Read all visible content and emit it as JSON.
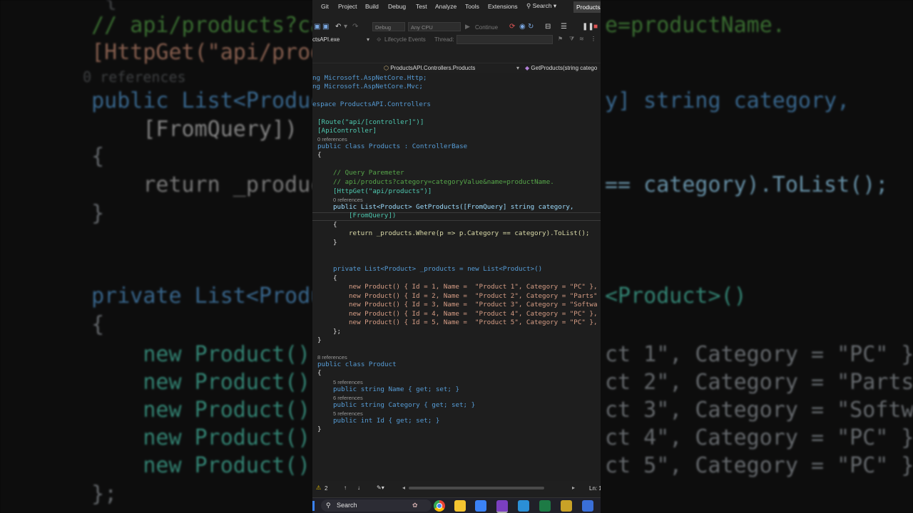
{
  "background_code": {
    "lines": [
      "   {",
      "  // api/products?cate",
      "  [HttpGet(\"api/produc",
      "  0 references",
      "  public List<Product>",
      "      [FromQuery])",
      "  {",
      "      return _products",
      "  }",
      "  private List<Product",
      "  {",
      "      new Product() {",
      "      new Product() {",
      "      new Product() {",
      "      new Product() {",
      "      new Product() {",
      "  };"
    ],
    "right_lines": [
      "e=productName.",
      "y] string category,",
      "== category).ToList();",
      "<Product>()",
      "ct 1\", Category = \"PC\" },",
      "ct 2\", Category = \"Parts\"",
      "ct 3\", Category = \"Softwa",
      "ct 4\", Category = \"PC\" },",
      "ct 5\", Category = \"PC\" },"
    ]
  },
  "menu": {
    "items": [
      "Git",
      "Project",
      "Build",
      "Debug",
      "Test",
      "Analyze",
      "Tools",
      "Extensions"
    ],
    "search_label": "Search",
    "project_badge": "ProductsAPI"
  },
  "toolbar": {
    "config": "Debug",
    "platform": "Any CPU",
    "continue_label": "Continue",
    "startup": "ctsAPI.exe",
    "lifecycle": "Lifecycle Events",
    "thread_label": "Thread:"
  },
  "navbar": {
    "class_path": "ProductsAPI.Controllers.Products",
    "member": "GetProducts(string catego"
  },
  "code": {
    "l01": "ng Microsoft.AspNetCore.Http;",
    "l02": "ng Microsoft.AspNetCore.Mvc;",
    "l03": "espace ProductsAPI.Controllers",
    "l04": "[Route(\"api/[controller]\")]",
    "l05": "[ApiController]",
    "r05": "0 references",
    "l06": "public class Products : ControllerBase",
    "l07": "{",
    "l08": "// Query Paremeter",
    "l09": "// api/products?category=categoryValue&name=productName.",
    "l10": "[HttpGet(\"api/products\")]",
    "r10": "0 references",
    "l11": "public List<Product> GetProducts([FromQuery] string category,",
    "l12": "[FromQuery])",
    "l13": "{",
    "l14": "return _products.Where(p => p.Category == category).ToList();",
    "l15": "}",
    "l16": "private List<Product> _products = new List<Product>()",
    "l17": "{",
    "p1": "new Product() { Id = 1, Name =  \"Product 1\", Category = \"PC\" },",
    "p2": "new Product() { Id = 2, Name =  \"Product 2\", Category = \"Parts\"",
    "p3": "new Product() { Id = 3, Name =  \"Product 3\", Category = \"Softwa",
    "p4": "new Product() { Id = 4, Name =  \"Product 4\", Category = \"PC\" },",
    "p5": "new Product() { Id = 5, Name =  \"Product 5\", Category = \"PC\" },",
    "l18": "};",
    "l19": "}",
    "r20": "8 references",
    "l20": "public class Product",
    "l21": "{",
    "r22": "5 references",
    "l22": "public string Name { get; set; }",
    "r23": "6 references",
    "l23": "public string Category { get; set; }",
    "r24": "5 references",
    "l24": "public int Id { get; set; }",
    "l25": "}"
  },
  "status": {
    "warnings": "2",
    "position": "Ln: 1"
  },
  "taskbar": {
    "search_label": "Search",
    "apps": [
      "chrome",
      "file-explorer",
      "store",
      "visual-studio",
      "vscode",
      "excel",
      "app",
      "remote"
    ]
  },
  "colors": {
    "keyword": "#569cd6",
    "type": "#4ec9b0",
    "string": "#d69d85",
    "comment": "#57a64a",
    "method": "#dcdcaa",
    "editor_bg": "#1e1e1e"
  }
}
